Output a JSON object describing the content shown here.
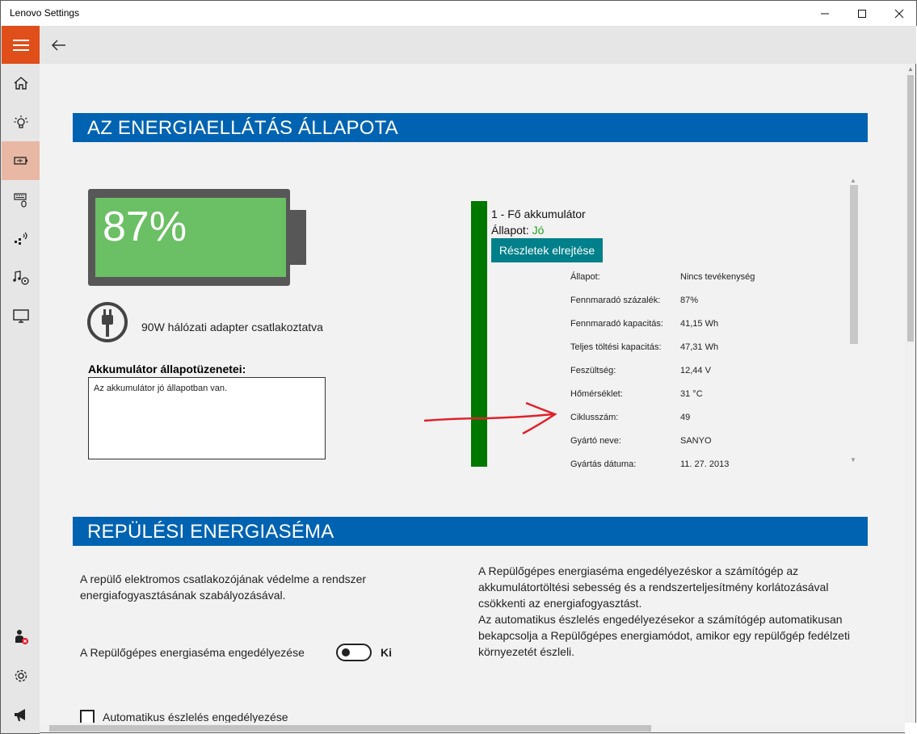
{
  "window": {
    "title": "Lenovo Settings",
    "controls": {
      "minimize": "—",
      "maximize": "☐",
      "close": "✕"
    }
  },
  "sidebar": {
    "items": [
      {
        "icon": "home-icon"
      },
      {
        "icon": "lightbulb-icon"
      },
      {
        "icon": "battery-icon",
        "active": true
      },
      {
        "icon": "keyboard-mouse-icon"
      },
      {
        "icon": "network-icon"
      },
      {
        "icon": "audio-camera-icon"
      },
      {
        "icon": "display-icon"
      }
    ],
    "bottom": [
      {
        "icon": "user-status-icon"
      },
      {
        "icon": "gear-icon"
      },
      {
        "icon": "megaphone-icon"
      }
    ]
  },
  "power_status": {
    "heading": "AZ ENERGIAELLÁTÁS ÁLLAPOTA",
    "battery_percent": "87%",
    "battery_level": 0.87,
    "adapter_text": "90W hálózati adapter csatlakoztatva",
    "messages_title": "Akkumulátor állapotüzenetei:",
    "messages_text": "Az akkumulátor jó állapotban van.",
    "battery": {
      "title": "1 - Fő akkumulátor",
      "state_label": "Állapot:",
      "state_value": "Jó",
      "details_button": "Részletek elrejtése",
      "details": [
        {
          "label": "Állapot:",
          "value": "Nincs tevékenység"
        },
        {
          "label": "Fennmaradó százalék:",
          "value": "87%"
        },
        {
          "label": "Fennmaradó kapacitás:",
          "value": "41,15 Wh"
        },
        {
          "label": "Teljes töltési kapacitás:",
          "value": "47,31 Wh"
        },
        {
          "label": "Feszültség:",
          "value": "12,44 V"
        },
        {
          "label": "Hőmérséklet:",
          "value": "31 °C"
        },
        {
          "label": "Ciklusszám:",
          "value": "49"
        },
        {
          "label": "Gyártó neve:",
          "value": "SANYO"
        },
        {
          "label": "Gyártás dátuma:",
          "value": "11. 27. 2013"
        }
      ]
    }
  },
  "airplane_mode": {
    "heading": "REPÜLÉSI ENERGIASÉMA",
    "description_left": "A repülő elektromos csatlakozójának védelme a rendszer energiafogyasztásának szabályozásával.",
    "description_right_1": "A Repülőgépes energiaséma engedélyezéskor a számítógép az akkumulátortöltési sebesség és a rendszerteljesítmény korlátozásával csökkenti az energiafogyasztást.",
    "description_right_2": "Az automatikus észlelés engedélyezésekor a számítógép automatikusan bekapcsolja a Repülőgépes energiamódot, amikor egy repülőgép fedélzeti környezetét észleli.",
    "toggle_label": "A Repülőgépes energiaséma engedélyezése",
    "toggle_state": "Ki",
    "auto_detect_label": "Automatikus észlelés engedélyezése"
  }
}
